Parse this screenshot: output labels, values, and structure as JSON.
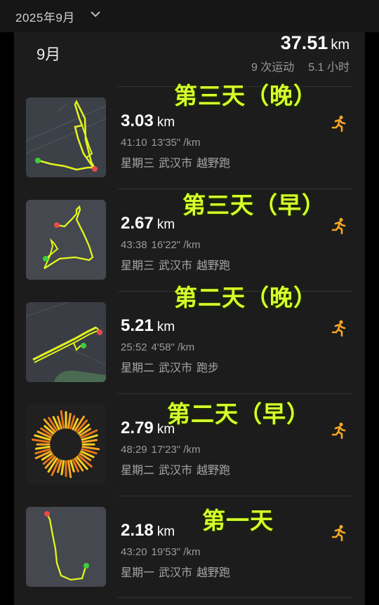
{
  "header": {
    "year_month": "2025年9月"
  },
  "month_label": "9月",
  "summary": {
    "distance": "37.51",
    "distance_unit": "km",
    "count": "9 次运动",
    "duration": "5.1 小时"
  },
  "activities": [
    {
      "distance": "3.03",
      "unit": "km",
      "time": "41:10",
      "pace": "13'35\" /km",
      "weekday": "星期三",
      "city": "武汉市",
      "type": "越野跑",
      "overlay": "第三天（晚）"
    },
    {
      "distance": "2.67",
      "unit": "km",
      "time": "43:38",
      "pace": "16'22\" /km",
      "weekday": "星期三",
      "city": "武汉市",
      "type": "越野跑",
      "overlay": "第三天（早）"
    },
    {
      "distance": "5.21",
      "unit": "km",
      "time": "25:52",
      "pace": "4'58\" /km",
      "weekday": "星期二",
      "city": "武汉市",
      "type": "跑步",
      "overlay": "第二天（晚）"
    },
    {
      "distance": "2.79",
      "unit": "km",
      "time": "48:29",
      "pace": "17'23\" /km",
      "weekday": "星期二",
      "city": "武汉市",
      "type": "越野跑",
      "overlay": "第二天（早）"
    },
    {
      "distance": "2.18",
      "unit": "km",
      "time": "43:20",
      "pace": "19'53\" /km",
      "weekday": "星期一",
      "city": "武汉市",
      "type": "越野跑",
      "overlay": "第一天"
    }
  ],
  "colors": {
    "route": "#e2f51c",
    "overlay_text": "#d7ff2c",
    "run_icon": "#f5a623",
    "start_dot": "#3ccf3c",
    "end_dot": "#e84a4a"
  },
  "icons": {
    "dropdown": "chevron-down-icon",
    "activity": "running-person-icon"
  }
}
